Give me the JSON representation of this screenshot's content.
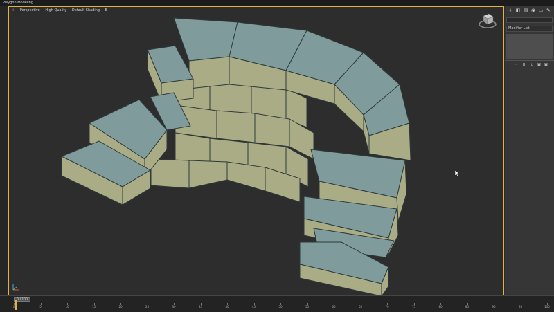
{
  "app": {
    "title": "Polygon Modeling"
  },
  "viewport": {
    "labels": {
      "plus": "+",
      "view": "Perspective",
      "quality": "High Quality",
      "shading": "Default Shading"
    },
    "indicator": "E"
  },
  "command_panel": {
    "tabs": [
      {
        "icon": "create-icon",
        "glyph": "+"
      },
      {
        "icon": "modify-icon",
        "glyph": "◧"
      },
      {
        "icon": "hierarchy-icon",
        "glyph": "▤"
      },
      {
        "icon": "motion-icon",
        "glyph": "◉"
      },
      {
        "icon": "display-icon",
        "glyph": "▭"
      },
      {
        "icon": "utilities-icon",
        "glyph": "✎"
      }
    ],
    "modifier_list": "Modifier List"
  },
  "timeline": {
    "slider_label": "0 / 100",
    "ticks": [
      "0",
      "5",
      "10",
      "15",
      "20",
      "25",
      "30",
      "35",
      "40",
      "45",
      "50",
      "55",
      "60",
      "65",
      "70",
      "75",
      "80",
      "85",
      "90",
      "95",
      "100"
    ]
  },
  "colors": {
    "viewport_border": "#e2b246",
    "block_top": "#7f9b9b",
    "block_side": "#a9ac85",
    "block_edge": "#2f3a3a"
  }
}
